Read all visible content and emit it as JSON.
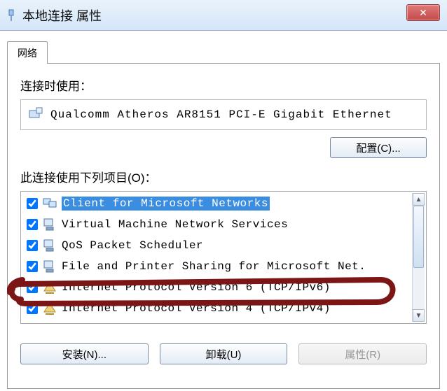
{
  "window": {
    "title": "本地连接 属性",
    "close_glyph": "✕"
  },
  "tab": {
    "label": "网络"
  },
  "labels": {
    "connect_using": "连接时使用：",
    "items_used": "此连接使用下列项目(O)："
  },
  "adapter": {
    "name": "Qualcomm Atheros AR8151 PCI-E Gigabit Ethernet"
  },
  "buttons": {
    "configure": "配置(C)...",
    "install": "安装(N)...",
    "uninstall": "卸载(U)",
    "properties": "属性(R)"
  },
  "items": [
    {
      "checked": true,
      "icon": "client-icon",
      "label": "Client for Microsoft Networks",
      "selected": true
    },
    {
      "checked": true,
      "icon": "service-icon",
      "label": "Virtual Machine Network Services"
    },
    {
      "checked": true,
      "icon": "service-icon",
      "label": "QoS Packet Scheduler"
    },
    {
      "checked": true,
      "icon": "service-icon",
      "label": "File and Printer Sharing for Microsoft Net."
    },
    {
      "checked": true,
      "icon": "protocol-icon",
      "label": "Internet Protocol Version 6 (TCP/IPv6)"
    },
    {
      "checked": true,
      "icon": "protocol-icon",
      "label": "Internet Protocol Version 4 (TCP/IPv4)"
    }
  ],
  "annotation": {
    "color": "#7c1616"
  }
}
